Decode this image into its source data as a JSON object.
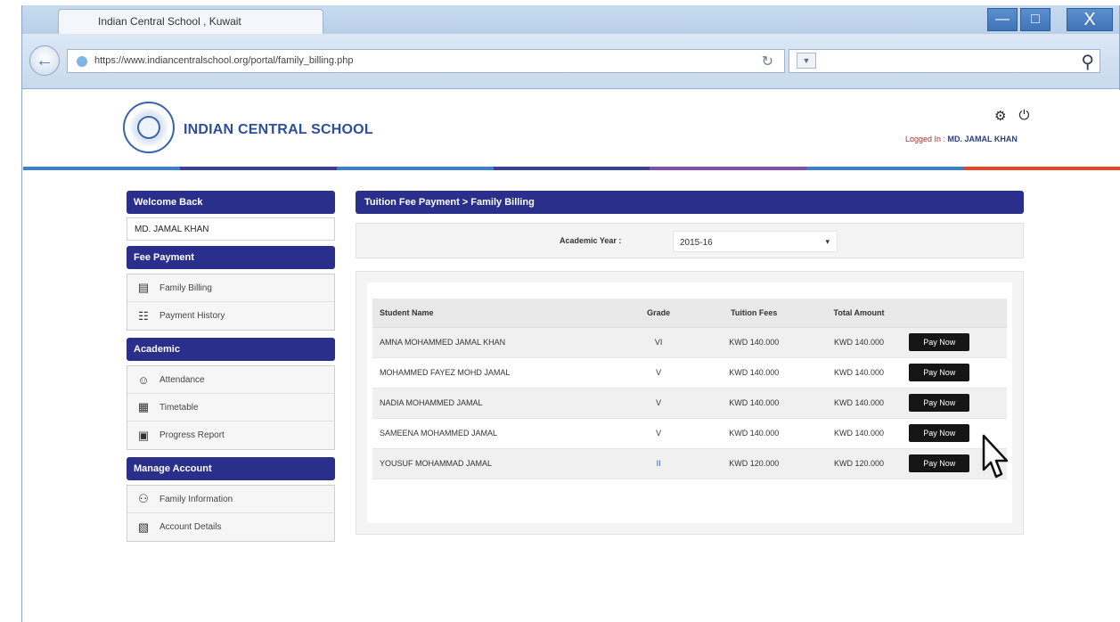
{
  "browser": {
    "tab_title": "Indian Central School , Kuwait",
    "url": "https://www.indiancentralschool.org/portal/family_billing.php",
    "win_min": "—",
    "win_max": "□",
    "win_close": "X",
    "back_icon": "back-arrow-icon",
    "search_icon": "search-icon"
  },
  "header": {
    "site_title": "INDIAN CENTRAL SCHOOL",
    "logged_prefix": "Logged In : ",
    "logged_user": "MD. JAMAL KHAN",
    "colors": [
      "#3c7fd0",
      "#3a3f9c",
      "#3c7fd0",
      "#3a3f9c",
      "#7c4fb0",
      "#3c7fd0",
      "#e8442a"
    ]
  },
  "sidebar": {
    "welcome_title": "Welcome Back",
    "user_name": "MD. JAMAL KHAN",
    "sections": [
      {
        "title": "Fee Payment",
        "items": [
          {
            "label": "Family Billing",
            "icon": "billing-icon"
          },
          {
            "label": "Payment History",
            "icon": "history-icon"
          }
        ]
      },
      {
        "title": "Academic",
        "items": [
          {
            "label": "Attendance",
            "icon": "attendance-icon"
          },
          {
            "label": "Timetable",
            "icon": "timetable-icon"
          },
          {
            "label": "Progress Report",
            "icon": "report-icon"
          }
        ]
      },
      {
        "title": "Manage Account",
        "items": [
          {
            "label": "Family Information",
            "icon": "family-icon"
          },
          {
            "label": "Account Details",
            "icon": "account-icon"
          }
        ]
      }
    ]
  },
  "main": {
    "title": "Tuition Fee Payment > Family Billing",
    "year_label": "Academic Year :",
    "year_value": "2015-16",
    "table": {
      "headers": [
        "Student Name",
        "Grade",
        "Tuition Fees",
        "Total Amount",
        ""
      ],
      "rows": [
        {
          "name": "AMNA MOHAMMED JAMAL KHAN",
          "grade": "VI",
          "fees": "KWD 140.000",
          "total": "KWD 140.000",
          "action": "Pay Now"
        },
        {
          "name": "MOHAMMED FAYEZ MOHD JAMAL",
          "grade": "V",
          "fees": "KWD 140.000",
          "total": "KWD 140.000",
          "action": "Pay Now"
        },
        {
          "name": "NADIA MOHAMMED JAMAL",
          "grade": "V",
          "fees": "KWD 140.000",
          "total": "KWD 140.000",
          "action": "Pay Now"
        },
        {
          "name": "SAMEENA MOHAMMED JAMAL",
          "grade": "V",
          "fees": "KWD 140.000",
          "total": "KWD 140.000",
          "action": "Pay Now"
        },
        {
          "name": "YOUSUF MOHAMMAD JAMAL",
          "grade": "II",
          "fees": "KWD 120.000",
          "total": "KWD 120.000",
          "action": "Pay Now"
        }
      ]
    }
  }
}
